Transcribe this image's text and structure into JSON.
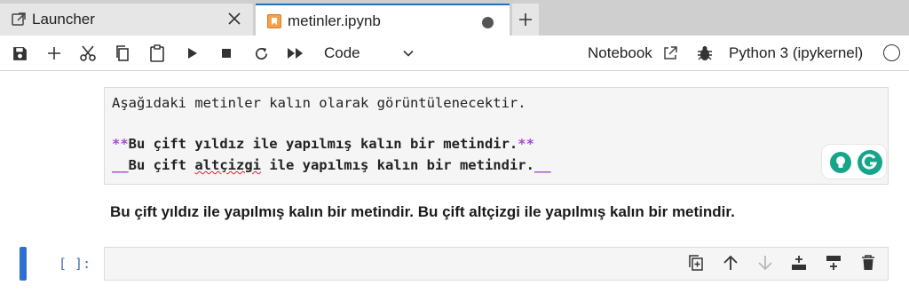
{
  "tabs": [
    {
      "label": "Launcher",
      "icon": "external-link-icon",
      "active": false
    },
    {
      "label": "metinler.ipynb",
      "icon": "notebook-icon",
      "active": true,
      "unsaved": true
    }
  ],
  "toolbar": {
    "buttons": [
      "save-icon",
      "plus-icon",
      "cut-icon",
      "copy-icon",
      "paste-icon",
      "run-icon",
      "stop-icon",
      "restart-icon",
      "fast-forward-icon"
    ],
    "cell_type": "Code",
    "notebook_label": "Notebook",
    "kernel_label": "Python 3 (ipykernel)"
  },
  "markdown_cell": {
    "line1": "Aşağıdaki metinler kalın olarak görüntülenecektir.",
    "line2_marker": "**",
    "line2_text": "Bu çift yıldız ile yapılmış kalın bir metindir.",
    "line3_marker": "__",
    "line3_before": "Bu çift ",
    "line3_misspelled": "altçizgi",
    "line3_after": " ile yapılmış kalın bir metindir.",
    "rendered": "Bu çift yıldız ile yapılmış kalın bir metindir. Bu çift altçizgi ile yapılmış kalın bir metindir."
  },
  "code_cell": {
    "prompt": "[ ]:",
    "toolbar": [
      "duplicate-icon",
      "move-up-icon",
      "move-down-icon",
      "insert-above-icon",
      "insert-below-icon",
      "delete-icon"
    ]
  },
  "colors": {
    "accent": "#1a73c8",
    "markdown_marker": "#a64bd1",
    "grammarly": "#16a589",
    "cell_bg": "#f5f5f5"
  }
}
